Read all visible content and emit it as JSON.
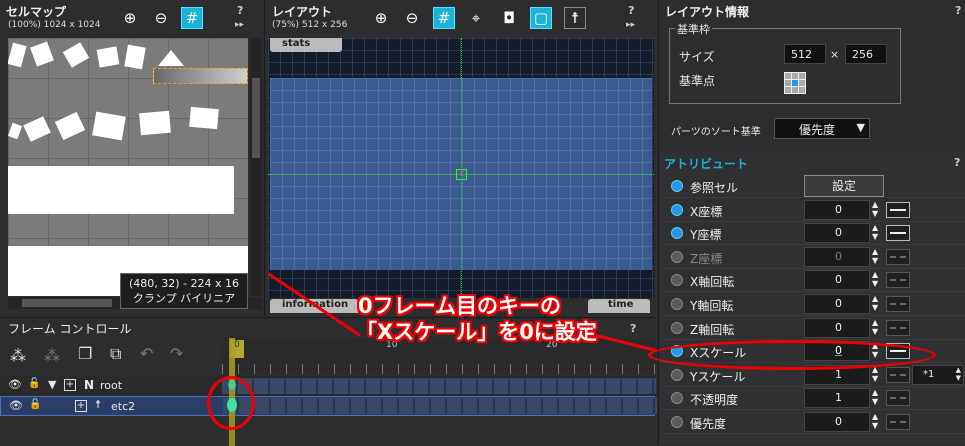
{
  "cellmap": {
    "title": "セルマップ",
    "info": "(100%) 1024 x 1024",
    "tooltip_coords": "(480, 32) - 224 x 16",
    "tooltip_mode": "クランプ バイリニア",
    "icons": [
      "zoom-in-icon",
      "zoom-out-icon",
      "grid-icon"
    ],
    "help": "?",
    "more": "▸▸"
  },
  "layout": {
    "title": "レイアウト",
    "info": "(75%) 512 x 256",
    "stats_tab": "stats",
    "information_tab": "information",
    "time_tab": "time",
    "help": "?",
    "more": "▸▸"
  },
  "layout_info": {
    "title": "レイアウト情報",
    "group_title": "基準枠",
    "size_label": "サイズ",
    "width": "512",
    "times": "×",
    "height": "256",
    "origin_label": "基準点",
    "sort_label": "パーツのソート基準",
    "sort_value": "優先度",
    "help": "?"
  },
  "attributes": {
    "title": "アトリビュート",
    "help": "?",
    "rows": [
      {
        "label": "参照セル",
        "dot": "blue",
        "button": "設定"
      },
      {
        "label": "X座標",
        "dot": "blue",
        "value": "0",
        "link": "solid"
      },
      {
        "label": "Y座標",
        "dot": "blue",
        "value": "0",
        "link": "solid"
      },
      {
        "label": "Z座標",
        "dot": "grey",
        "value": "0",
        "link": "dash",
        "dim": true
      },
      {
        "label": "X軸回転",
        "dot": "grey",
        "value": "0",
        "link": "dash"
      },
      {
        "label": "Y軸回転",
        "dot": "grey",
        "value": "0",
        "link": "dash"
      },
      {
        "label": "Z軸回転",
        "dot": "grey",
        "value": "0",
        "link": "dash"
      },
      {
        "label": "Xスケール",
        "dot": "blue",
        "value": "0",
        "link": "solid",
        "active": true
      },
      {
        "label": "Yスケール",
        "dot": "grey",
        "value": "1",
        "link": "dash",
        "extra": "*1"
      },
      {
        "label": "不透明度",
        "dot": "grey",
        "value": "1",
        "link": "dash"
      },
      {
        "label": "優先度",
        "dot": "grey",
        "value": "0",
        "link": "dash"
      }
    ]
  },
  "frame_control": {
    "title": "フレーム コントロール",
    "help": "?",
    "ruler": [
      "0",
      "10",
      "20"
    ],
    "tracks": [
      {
        "name": "root",
        "prefix": "N"
      },
      {
        "name": "etc2",
        "prefix": ""
      }
    ]
  },
  "annotation": {
    "line1": "0フレーム目のキーの",
    "line2": "「Xスケール」を0に設定"
  },
  "colors": {
    "accent": "#19b4d8",
    "highlight": "#e00000",
    "canvas": "#3b5a8f"
  }
}
